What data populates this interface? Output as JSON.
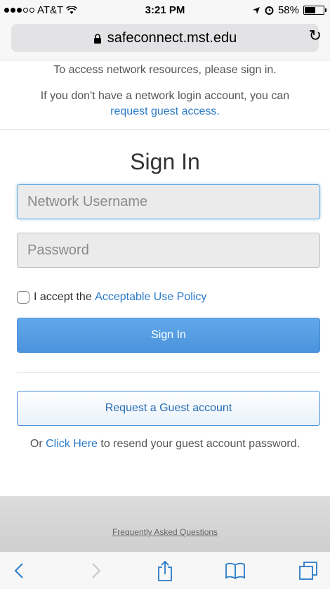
{
  "status_bar": {
    "carrier": "AT&T",
    "time": "3:21 PM",
    "battery": "58%",
    "battery_level": 0.58,
    "signal_bars": 3
  },
  "url_bar": {
    "domain": "safeconnect.mst.edu",
    "lock_icon": "lock-icon",
    "reload_icon": "reload-icon"
  },
  "page": {
    "notice_line1": "To access network resources, please sign in.",
    "notice_line2_prefix": "If you don't have a network login account, you can",
    "guest_link": "request guest access.",
    "title": "Sign In",
    "username_placeholder": "Network Username",
    "password_placeholder": "Password",
    "accept_prefix": "I accept the",
    "policy_link": "Acceptable Use Policy",
    "sign_in_button": "Sign In",
    "guest_button": "Request a Guest account",
    "resend_prefix": "Or",
    "resend_link": "Click Here",
    "resend_suffix": "to resend your guest account password.",
    "faq_link": "Frequently Asked Questions"
  },
  "toolbar": {
    "back_icon": "back-icon",
    "forward_icon": "forward-icon",
    "share_icon": "share-icon",
    "bookmarks_icon": "bookmarks-icon",
    "tabs_icon": "tabs-icon"
  },
  "colors": {
    "link": "#2a7ac8",
    "primary_button": "#4b93dc",
    "accent": "#2a6fb2"
  }
}
